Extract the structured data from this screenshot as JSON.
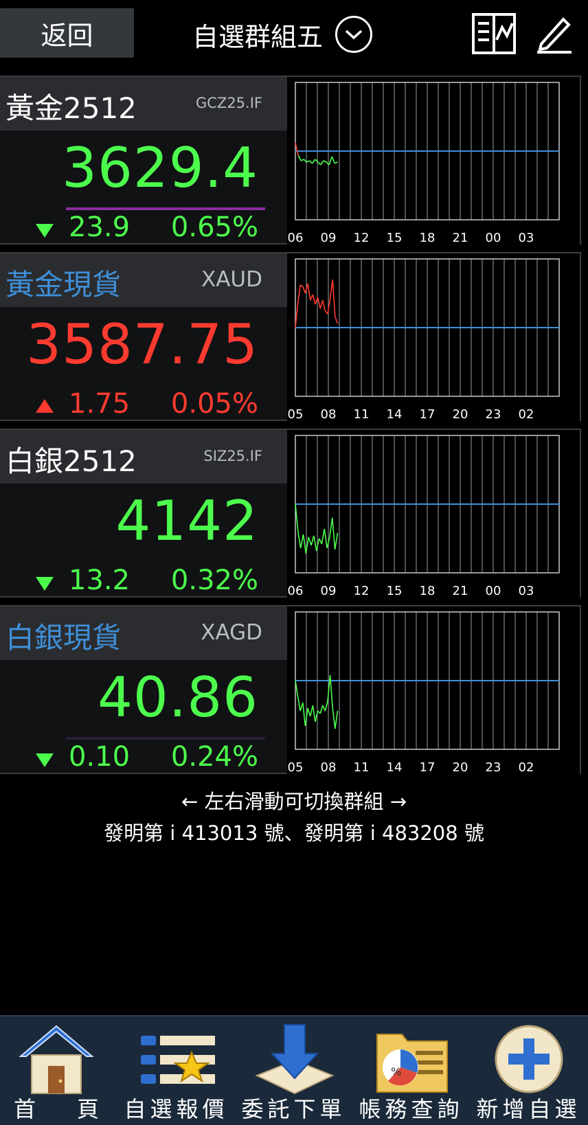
{
  "header": {
    "back_label": "返回",
    "title": "自選群組五",
    "icons": [
      "chevron-down-icon",
      "layout-icon",
      "edit-icon"
    ]
  },
  "quotes": [
    {
      "name": "黃金2512",
      "code": "GCZ25.IF",
      "name_color": "#ffffff",
      "price": "3629.4",
      "change": "23.9",
      "percent": "0.65%",
      "direction": "down",
      "color": "#4dff4d",
      "underline_color": "#8a2d9e",
      "x_ticks": [
        "06",
        "09",
        "12",
        "15",
        "18",
        "21",
        "00",
        "03"
      ]
    },
    {
      "name": "黃金現貨",
      "code": "XAUD",
      "name_color": "#3f8fd8",
      "price": "3587.75",
      "change": "1.75",
      "percent": "0.05%",
      "direction": "up",
      "color": "#ff3b30",
      "underline_color": "",
      "x_ticks": [
        "05",
        "08",
        "11",
        "14",
        "17",
        "20",
        "23",
        "02"
      ]
    },
    {
      "name": "白銀2512",
      "code": "SIZ25.IF",
      "name_color": "#ffffff",
      "price": "4142",
      "change": "13.2",
      "percent": "0.32%",
      "direction": "down",
      "color": "#4dff4d",
      "underline_color": "",
      "x_ticks": [
        "06",
        "09",
        "12",
        "15",
        "18",
        "21",
        "00",
        "03"
      ]
    },
    {
      "name": "白銀現貨",
      "code": "XAGD",
      "name_color": "#3f8fd8",
      "price": "40.86",
      "change": "0.10",
      "percent": "0.24%",
      "direction": "down",
      "color": "#4dff4d",
      "underline_color": "#2a1f3a",
      "x_ticks": [
        "05",
        "08",
        "11",
        "14",
        "17",
        "20",
        "23",
        "02"
      ]
    }
  ],
  "hint": {
    "swipe": "← 左右滑動可切換群組 →",
    "patent": "發明第 i 413013 號、發明第 i 483208 號"
  },
  "tabbar": {
    "items": [
      {
        "label": "首頁",
        "icon": "home-icon"
      },
      {
        "label": "自選報價",
        "icon": "watchlist-icon"
      },
      {
        "label": "委託下單",
        "icon": "order-download-icon"
      },
      {
        "label": "帳務查詢",
        "icon": "account-folder-icon"
      },
      {
        "label": "新增自選",
        "icon": "add-icon"
      }
    ]
  },
  "chart_data": [
    {
      "type": "line",
      "baseline": "prev-close",
      "series": [
        {
          "values": [
            0.44,
            0.53,
            0.57,
            0.56,
            0.58,
            0.57,
            0.59,
            0.56,
            0.58,
            0.6,
            0.57,
            0.58,
            0.6,
            0.54,
            0.59,
            0.58
          ]
        }
      ],
      "x": [
        "06",
        "09",
        "12",
        "15",
        "18",
        "21",
        "00",
        "03"
      ]
    },
    {
      "type": "line",
      "baseline": "prev-close",
      "series": [
        {
          "values": [
            0.5,
            0.32,
            0.19,
            0.2,
            0.25,
            0.18,
            0.3,
            0.26,
            0.33,
            0.28,
            0.36,
            0.3,
            0.38,
            0.4,
            0.29,
            0.15,
            0.42,
            0.47
          ]
        }
      ],
      "x": [
        "05",
        "08",
        "11",
        "14",
        "17",
        "20",
        "23",
        "02"
      ]
    },
    {
      "type": "line",
      "baseline": "prev-close",
      "series": [
        {
          "values": [
            0.5,
            0.7,
            0.82,
            0.72,
            0.86,
            0.74,
            0.8,
            0.73,
            0.84,
            0.75,
            0.79,
            0.68,
            0.82,
            0.74,
            0.6,
            0.83,
            0.71
          ]
        }
      ],
      "x": [
        "06",
        "09",
        "12",
        "15",
        "18",
        "21",
        "00",
        "03"
      ]
    },
    {
      "type": "line",
      "baseline": "prev-close",
      "series": [
        {
          "values": [
            0.5,
            0.62,
            0.72,
            0.66,
            0.83,
            0.7,
            0.76,
            0.68,
            0.8,
            0.72,
            0.74,
            0.68,
            0.72,
            0.65,
            0.46,
            0.7,
            0.85,
            0.72
          ]
        }
      ],
      "x": [
        "05",
        "08",
        "11",
        "14",
        "17",
        "20",
        "23",
        "02"
      ]
    }
  ]
}
